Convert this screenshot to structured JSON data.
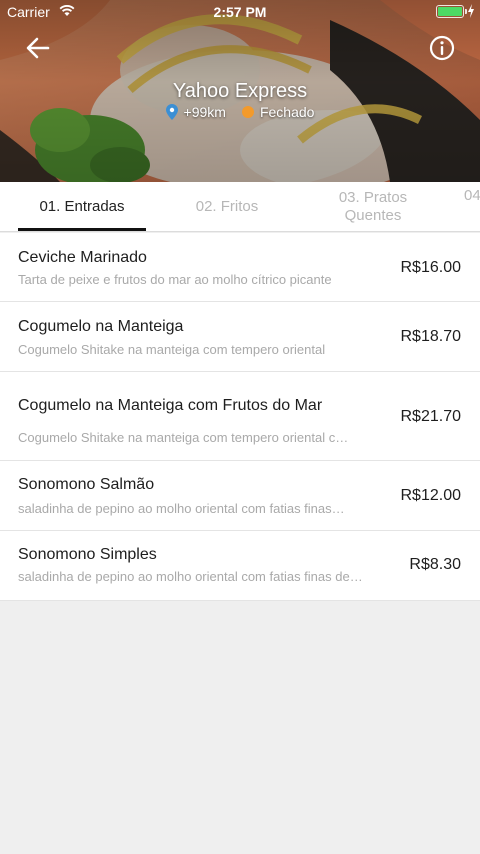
{
  "status_bar": {
    "carrier": "Carrier",
    "time": "2:57 PM",
    "battery_color": "#4cd964"
  },
  "header": {
    "back_icon": "arrow-left-icon",
    "info_icon": "info-circle-icon",
    "store_name": "Yahoo Express",
    "distance": "+99km",
    "distance_icon_color": "#3b8fd4",
    "open_status": "Fechado",
    "open_status_color": "#f39a2b"
  },
  "tabs": [
    {
      "label": "01. Entradas",
      "active": true
    },
    {
      "label": "02. Fritos",
      "active": false
    },
    {
      "label": "03. Pratos Quentes",
      "active": false
    },
    {
      "label": "04",
      "active": false
    }
  ],
  "menu": {
    "items": [
      {
        "name": "Ceviche Marinado",
        "description": "Tarta de peixe e frutos do mar ao molho cítrico picante",
        "price": "R$16.00"
      },
      {
        "name": "Cogumelo na Manteiga",
        "description": "Cogumelo Shitake na manteiga com tempero oriental",
        "price": "R$18.70"
      },
      {
        "name": "Cogumelo na Manteiga com Frutos do Mar",
        "description": "Cogumelo Shitake na manteiga com tempero oriental c…",
        "price": "R$21.70"
      },
      {
        "name": "Sonomono Salmão",
        "description": "saladinha de pepino ao molho oriental com fatias finas…",
        "price": "R$12.00"
      },
      {
        "name": "Sonomono Simples",
        "description": "saladinha de pepino ao molho oriental com fatias finas de…",
        "price": "R$8.30"
      }
    ]
  }
}
